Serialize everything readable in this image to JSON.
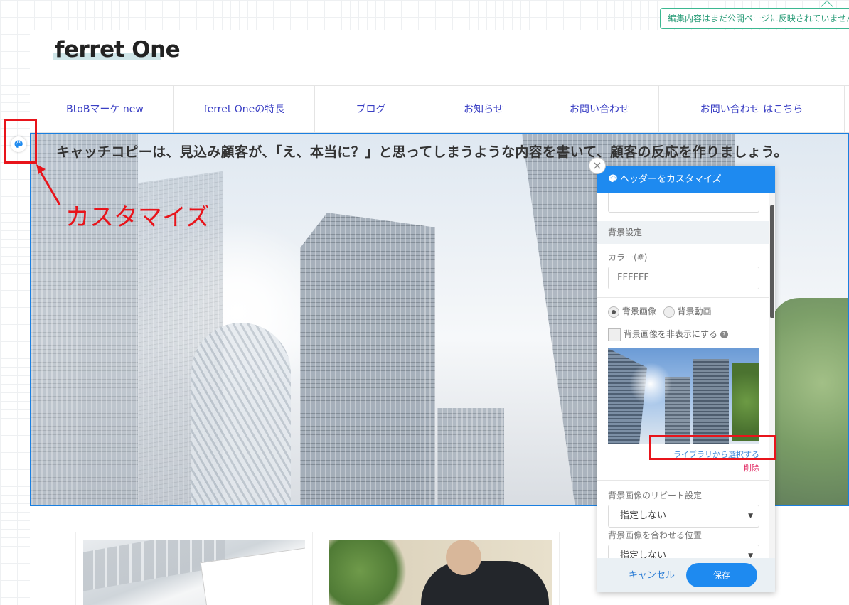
{
  "notice": {
    "text": "編集内容はまだ公開ページに反映されていません"
  },
  "site": {
    "logo": "ferret One"
  },
  "nav": {
    "items": [
      {
        "label": "BtoBマーケ new"
      },
      {
        "label": "ferret Oneの特長"
      },
      {
        "label": "ブログ"
      },
      {
        "label": "お知らせ"
      },
      {
        "label": "お問い合わせ"
      },
      {
        "label": "お問い合わせ はこちら"
      }
    ]
  },
  "hero": {
    "catchcopy": "キャッチコピーは、見込み顧客が、「え、本当に？」と思ってしまうような内容を書いて、顧客の反応を作りましょう。"
  },
  "annotation": {
    "callout": "カスタマイズ",
    "color": "#e8141b"
  },
  "panel": {
    "title": "ヘッダーをカスタマイズ",
    "close_symbol": "×",
    "section_bg": "背景設定",
    "color_label": "カラー(#)",
    "color_value": "FFFFFF",
    "radio_image": "背景画像",
    "radio_video": "背景動画",
    "radio_selected": "背景画像",
    "hide_image_label": "背景画像を非表示にする",
    "select_from_library": "ライブラリから選択する",
    "delete": "削除",
    "repeat_label": "背景画像のリピート設定",
    "repeat_value": "指定しない",
    "position_label": "背景画像を合わせる位置",
    "position_value": "指定しない",
    "cancel": "キャンセル",
    "save": "保存"
  },
  "colors": {
    "accent": "#1e8af0",
    "highlight": "#e8141b",
    "nav_link": "#3a3fc4"
  }
}
